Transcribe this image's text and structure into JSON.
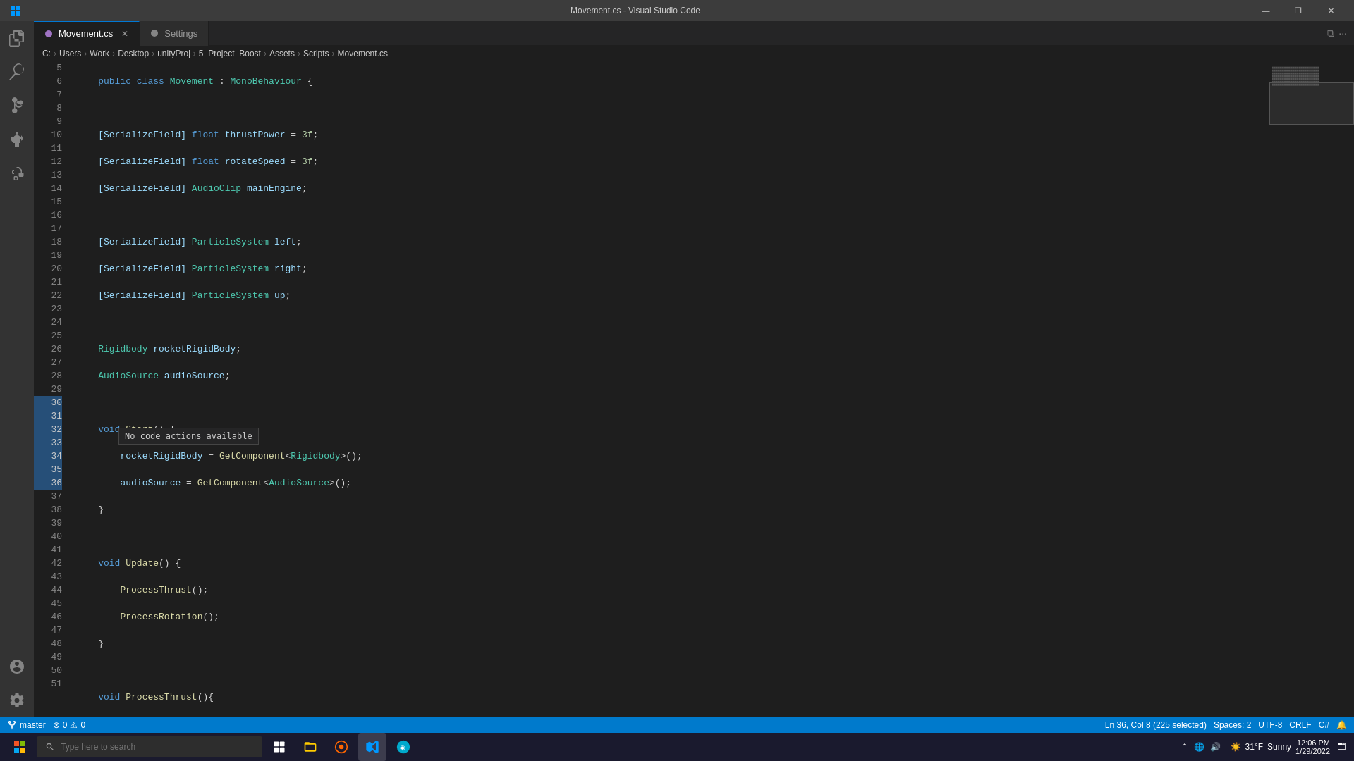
{
  "titlebar": {
    "title": "Movement.cs - Visual Studio Code",
    "min": "—",
    "max": "❐",
    "close": "✕"
  },
  "tabs": [
    {
      "id": "movement",
      "label": "Movement.cs",
      "active": true
    },
    {
      "id": "settings",
      "label": "Settings",
      "active": false
    }
  ],
  "breadcrumb": {
    "path": [
      "C:",
      "Users",
      "Work",
      "Desktop",
      "unityProj",
      "5_Project_Boost",
      "Assets",
      "Scripts",
      "Movement.cs"
    ]
  },
  "statusbar": {
    "branch": "master",
    "errors": "0",
    "warnings": "0",
    "position": "Ln 36, Col 8 (225 selected)",
    "spaces": "Spaces: 2",
    "encoding": "UTF-8",
    "line_ending": "CRLF",
    "language": "C#"
  },
  "taskbar": {
    "search_placeholder": "Type here to search",
    "time": "12:06 PM",
    "date": "1/29/2022",
    "temperature": "31°F",
    "weather": "Sunny"
  },
  "tooltip": {
    "text": "No code actions available"
  },
  "minimap": {
    "highlight_color": "#264f78"
  }
}
